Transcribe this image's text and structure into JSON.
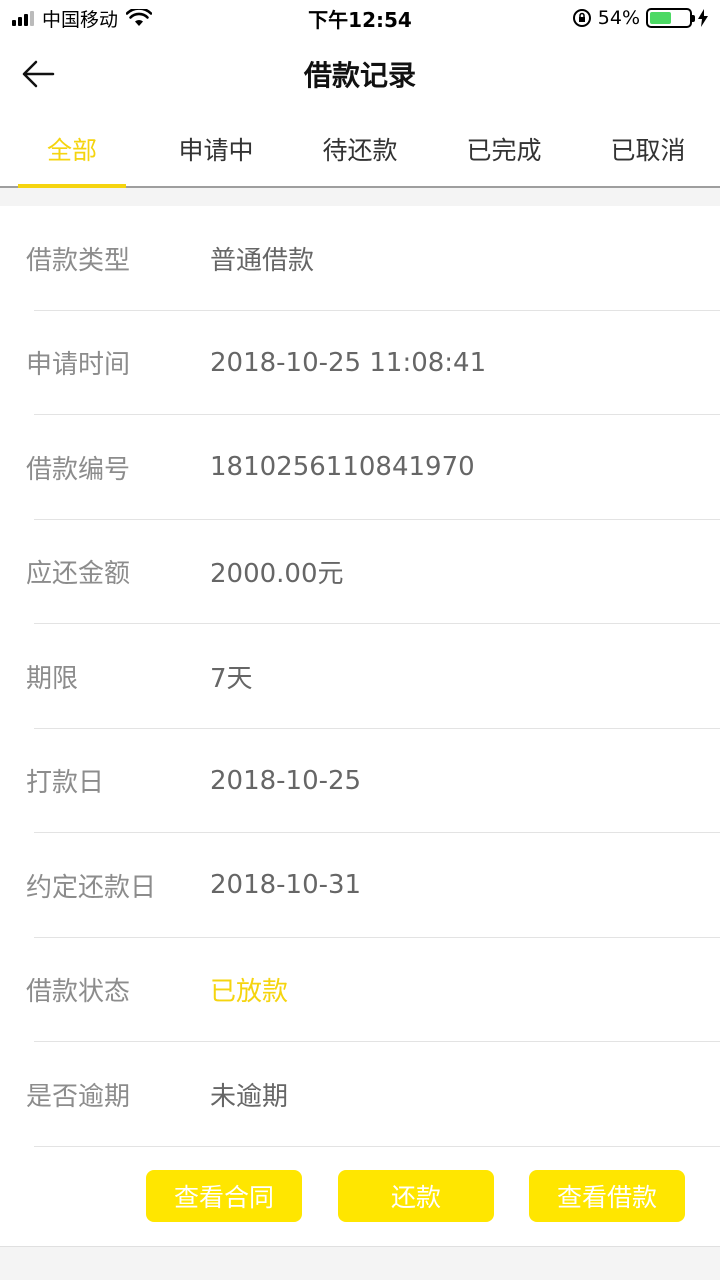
{
  "status_bar": {
    "carrier": "中国移动",
    "time": "下午12:54",
    "battery_percent": "54%",
    "battery_level": 0.54,
    "icons": [
      "signal-icon",
      "wifi-icon",
      "orientation-lock-icon",
      "battery-icon",
      "charging-icon"
    ]
  },
  "nav": {
    "title": "借款记录",
    "back_icon": "back-arrow-icon"
  },
  "tabs": [
    {
      "label": "全部",
      "active": true
    },
    {
      "label": "申请中",
      "active": false
    },
    {
      "label": "待还款",
      "active": false
    },
    {
      "label": "已完成",
      "active": false
    },
    {
      "label": "已取消",
      "active": false
    }
  ],
  "details": [
    {
      "label": "借款类型",
      "value": "普通借款"
    },
    {
      "label": "申请时间",
      "value": "2018-10-25 11:08:41"
    },
    {
      "label": "借款编号",
      "value": "1810256110841970"
    },
    {
      "label": "应还金额",
      "value": "2000.00元"
    },
    {
      "label": "期限",
      "value": "7天"
    },
    {
      "label": "打款日",
      "value": "2018-10-25"
    },
    {
      "label": "约定还款日",
      "value": "2018-10-31"
    },
    {
      "label": "借款状态",
      "value": "已放款"
    },
    {
      "label": "是否逾期",
      "value": "未逾期"
    }
  ],
  "buttons": {
    "view_contract": "查看合同",
    "repay": "还款",
    "view_loan": "查看借款"
  },
  "colors": {
    "accent": "#f5d40f",
    "button_bg": "#ffe600",
    "battery_green": "#4cd964"
  }
}
